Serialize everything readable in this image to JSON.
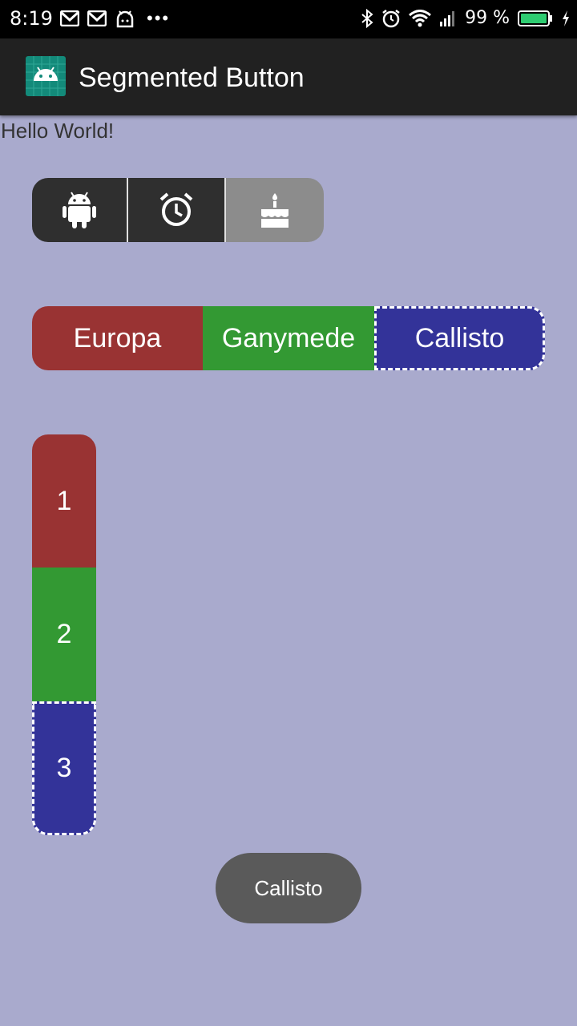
{
  "status_bar": {
    "time": "8:19",
    "battery_percent": "99 %",
    "icons_left": [
      "gmail-icon",
      "gmail-icon",
      "android-debug-icon",
      "more-dots-icon"
    ],
    "icons_right": [
      "bluetooth-icon",
      "alarm-icon",
      "wifi-icon",
      "signal-icon",
      "battery-icon",
      "charging-icon"
    ]
  },
  "app_bar": {
    "title": "Segmented Button",
    "icon": "android-app-icon"
  },
  "content": {
    "hello": "Hello World!"
  },
  "icon_segment": {
    "buttons": [
      {
        "icon": "android-icon",
        "selected": false
      },
      {
        "icon": "alarm-clock-icon",
        "selected": false
      },
      {
        "icon": "cake-icon",
        "selected": true
      }
    ]
  },
  "moons_segment": {
    "buttons": [
      {
        "label": "Europa",
        "color": "#993333",
        "selected": false
      },
      {
        "label": "Ganymede",
        "color": "#339933",
        "selected": false
      },
      {
        "label": "Callisto",
        "color": "#333399",
        "selected": true
      }
    ]
  },
  "vertical_segment": {
    "buttons": [
      {
        "label": "1",
        "color": "#993333",
        "selected": false
      },
      {
        "label": "2",
        "color": "#339933",
        "selected": false
      },
      {
        "label": "3",
        "color": "#333399",
        "selected": true
      }
    ]
  },
  "toast": {
    "text": "Callisto"
  },
  "colors": {
    "background": "#a9aacd",
    "app_bar": "#212121",
    "toast": "#5a5a5a"
  }
}
